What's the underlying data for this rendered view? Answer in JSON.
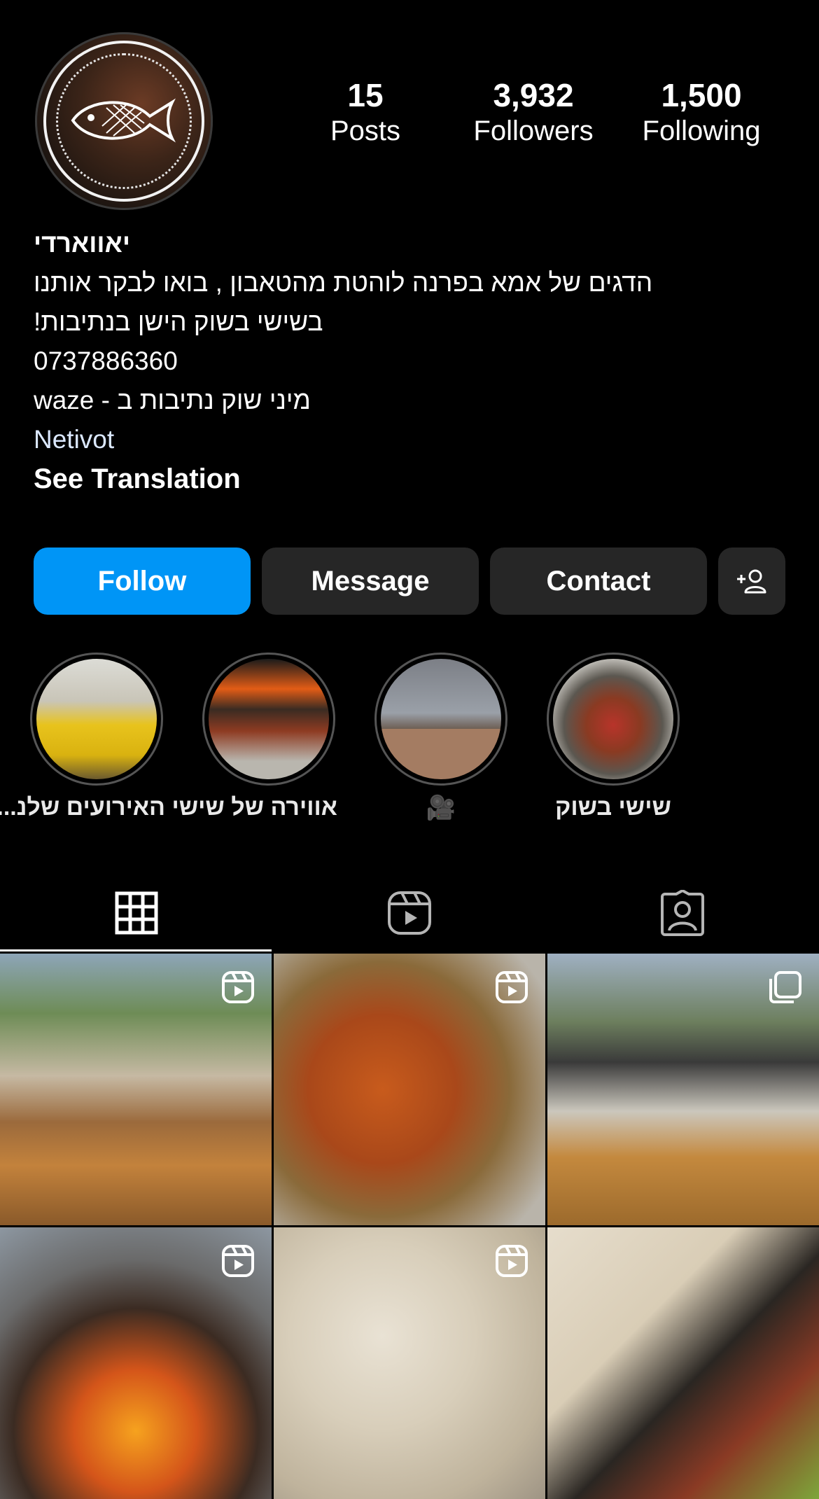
{
  "profile": {
    "stats": [
      {
        "value": "15",
        "label": "Posts"
      },
      {
        "value": "3,932",
        "label": "Followers"
      },
      {
        "value": "1,500",
        "label": "Following"
      }
    ],
    "bio": {
      "name": "יאווארדי",
      "line1": "הדגים של אמא בפרנה לוהטת מהטאבון , בואו לבקר אותנו",
      "line2": "בשישי בשוק הישן בנתיבות!",
      "phone": "0737886360",
      "line4": "מיני שוק נתיבות ב - waze",
      "link": "Netivot",
      "see_translation": "See Translation"
    }
  },
  "actions": {
    "follow": "Follow",
    "message": "Message",
    "contact": "Contact"
  },
  "highlights": [
    {
      "label": "שישי בשוק"
    },
    {
      "label": "🎥"
    },
    {
      "label": "אווירה של שישי"
    },
    {
      "label": "האירועים שלנ..."
    }
  ],
  "tabs": [
    "grid",
    "reels",
    "tagged"
  ],
  "colors": {
    "accent": "#0095f6",
    "button": "#262626",
    "link": "#dbe8ff"
  },
  "posts": [
    {
      "type": "reel"
    },
    {
      "type": "reel"
    },
    {
      "type": "carousel"
    },
    {
      "type": "reel"
    },
    {
      "type": "reel"
    },
    {
      "type": "photo"
    }
  ]
}
